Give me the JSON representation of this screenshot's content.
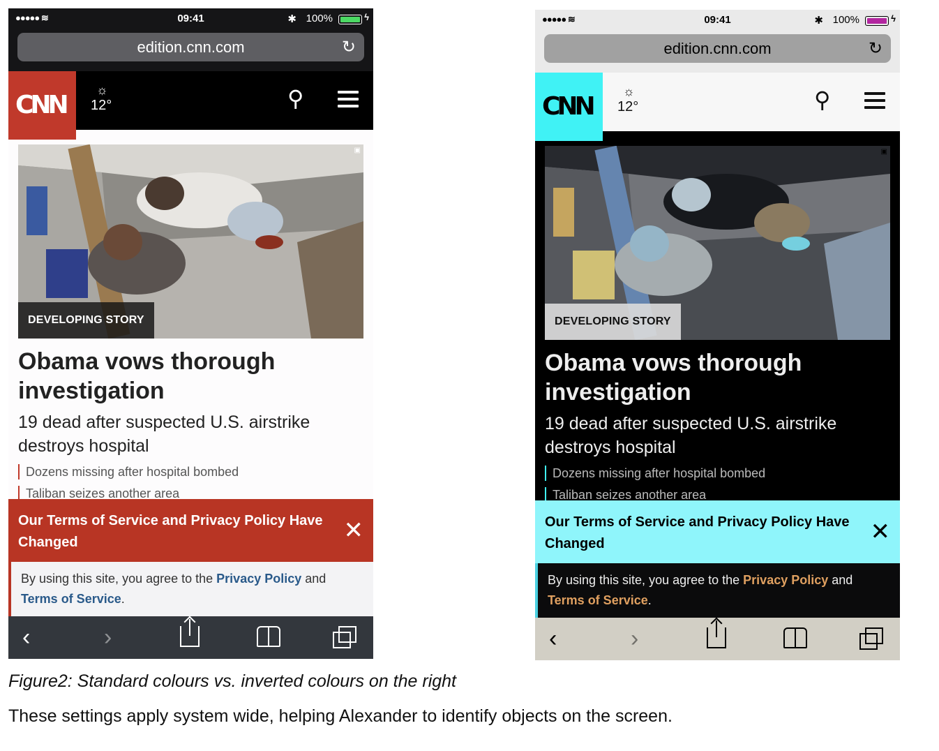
{
  "standard": {
    "status": {
      "signal": "●●●●● ≋",
      "time": "09:41",
      "battery_pct": "100%"
    },
    "url": "edition.cnn.com",
    "logo_text": "CNN",
    "weather_temp": "12°",
    "badge": "DEVELOPING STORY",
    "headline": "Obama vows thorough investigation",
    "subhead": "19 dead after suspected U.S. airstrike destroys hospital",
    "related": [
      "Dozens missing after hospital bombed",
      "Taliban seizes another area"
    ],
    "terms_title": "Our Terms of Service and Privacy Policy Have Changed",
    "terms_intro": "By using this site, you agree to the ",
    "terms_privacy": "Privacy Policy",
    "terms_and": " and ",
    "terms_tos": "Terms of Service",
    "terms_end": "."
  },
  "inverted": {
    "status": {
      "signal": "●●●●● ≋",
      "time": "09:41",
      "battery_pct": "100%"
    },
    "url": "edition.cnn.com",
    "logo_text": "CNN",
    "weather_temp": "12°",
    "badge": "DEVELOPING STORY",
    "headline": "Obama vows thorough investigation",
    "subhead": "19 dead after suspected U.S. airstrike destroys hospital",
    "related": [
      "Dozens missing after hospital bombed",
      "Taliban seizes another area"
    ],
    "terms_title": "Our Terms of Service and Privacy Policy Have Changed",
    "terms_intro": "By using this site, you agree to the ",
    "terms_privacy": "Privacy Policy",
    "terms_and": " and ",
    "terms_tos": "Terms of Service",
    "terms_end": "."
  },
  "icons": [
    "reload-icon",
    "sun-icon",
    "search-icon",
    "menu-icon",
    "close-icon",
    "back-icon",
    "forward-icon",
    "share-icon",
    "bookmarks-icon",
    "tabs-icon"
  ],
  "colors": {
    "standard_accent": "#c0392b",
    "standard_link": "#2a5a8a",
    "inverted_accent": "#40f2f5",
    "inverted_link": "#e0a060"
  },
  "caption": "Figure2: Standard colours vs. inverted colours on the right",
  "body_text": "These settings apply system wide, helping Alexander to identify objects on the screen."
}
